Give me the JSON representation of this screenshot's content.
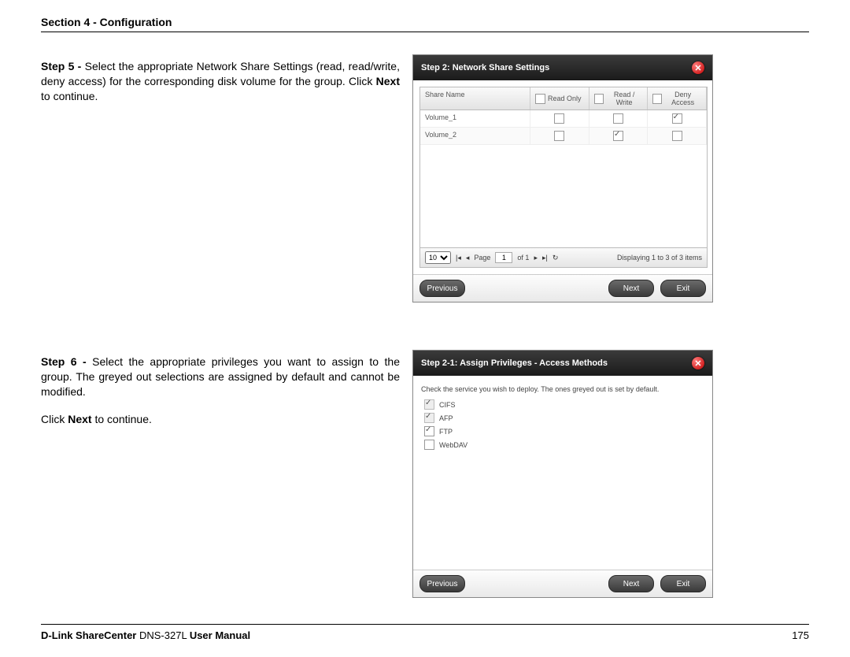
{
  "section_header": "Section 4 - Configuration",
  "step5": {
    "label": "Step 5 - ",
    "text": "Select the appropriate Network Share Settings (read, read/write, deny access) for the corresponding disk volume for the group. Click ",
    "bold": "Next",
    "text_end": " to continue."
  },
  "step6": {
    "label": "Step 6 - ",
    "text": "Select the appropriate privileges you want to assign to the group. The greyed out selections are assigned by default and cannot be modified.",
    "line2a": "Click ",
    "line2b": "Next",
    "line2c": " to continue."
  },
  "dialog1": {
    "title": "Step 2: Network Share Settings",
    "columns": {
      "name": "Share Name",
      "ro": "Read Only",
      "rw": "Read / Write",
      "deny": "Deny Access"
    },
    "rows": [
      {
        "name": "Volume_1",
        "ro": false,
        "rw": false,
        "deny": true
      },
      {
        "name": "Volume_2",
        "ro": false,
        "rw": true,
        "deny": false
      }
    ],
    "pager": {
      "size": "10",
      "page_label": "Page",
      "page": "1",
      "of_label": "of 1",
      "summary": "Displaying 1 to 3 of 3 items"
    },
    "buttons": {
      "previous": "Previous",
      "next": "Next",
      "exit": "Exit"
    }
  },
  "dialog2": {
    "title": "Step 2-1: Assign Privileges - Access Methods",
    "note": "Check the service you wish to deploy. The ones greyed out is set by default.",
    "services": [
      {
        "label": "CIFS",
        "checked": true,
        "disabled": true
      },
      {
        "label": "AFP",
        "checked": true,
        "disabled": true
      },
      {
        "label": "FTP",
        "checked": true,
        "disabled": false
      },
      {
        "label": "WebDAV",
        "checked": false,
        "disabled": false
      }
    ],
    "buttons": {
      "previous": "Previous",
      "next": "Next",
      "exit": "Exit"
    }
  },
  "footer": {
    "brand_bold1": "D-Link ShareCenter",
    "model": " DNS-327L ",
    "brand_bold2": "User Manual",
    "page_number": "175"
  }
}
